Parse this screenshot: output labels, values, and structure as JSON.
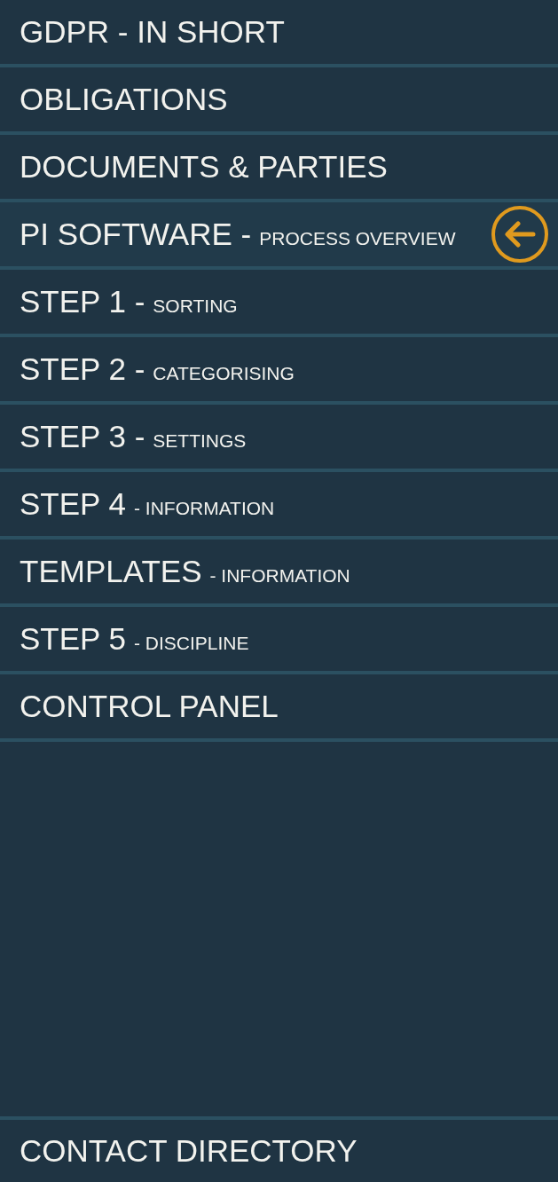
{
  "menu": {
    "items": [
      {
        "label": "GDPR - IN SHORT",
        "selected": false
      },
      {
        "label": "OBLIGATIONS",
        "selected": false
      },
      {
        "label": "DOCUMENTS & PARTIES",
        "selected": false
      },
      {
        "label": "PI SOFTWARE -",
        "sublabel": "PROCESS OVERVIEW",
        "selected": true
      },
      {
        "label": "STEP 1 -",
        "sublabel": "SORTING",
        "selected": false
      },
      {
        "label": "STEP 2 -",
        "sublabel": "CATEGORISING",
        "selected": false
      },
      {
        "label": "STEP 3 -",
        "sublabel": "SETTINGS",
        "selected": false
      },
      {
        "label": "STEP 4",
        "sublabel": "- INFORMATION",
        "selected": false
      },
      {
        "label": "TEMPLATES",
        "sublabel": "- INFORMATION",
        "selected": false
      },
      {
        "label": "STEP 5",
        "sublabel": "- DISCIPLINE",
        "selected": false
      },
      {
        "label": "CONTROL PANEL",
        "selected": false
      }
    ]
  },
  "footer_item": {
    "label": "CONTACT DIRECTORY"
  }
}
